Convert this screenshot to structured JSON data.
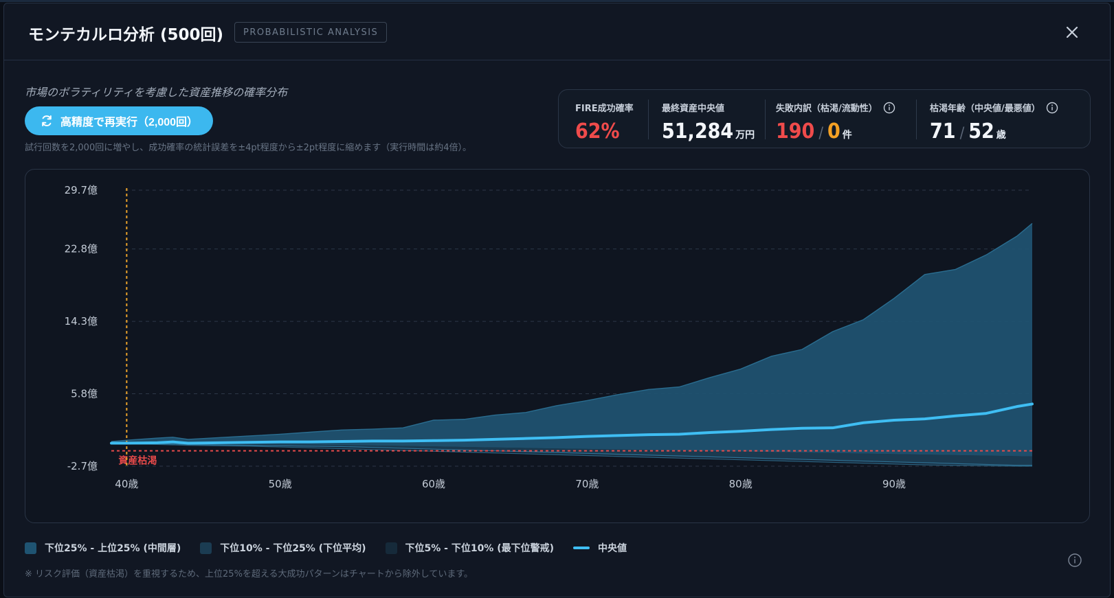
{
  "header": {
    "title": "モンテカルロ分析 (500回)",
    "badge": "PROBABILISTIC ANALYSIS"
  },
  "subtitle": "市場のボラティリティを考慮した資産推移の確率分布",
  "rerun": {
    "label": "高精度で再実行（2,000回）",
    "note": "試行回数を2,000回に増やし、成功確率の統計誤差を±4pt程度から±2pt程度に縮めます（実行時間は約4倍）。"
  },
  "stats": {
    "success": {
      "label": "FIRE成功確率",
      "value": "62%"
    },
    "median_final": {
      "label": "最終資産中央値",
      "value": "51,284",
      "unit": "万円"
    },
    "failure": {
      "label": "失敗内訳（枯渇/流動性）",
      "depletion": "190",
      "liquidity": "0",
      "unit": "件"
    },
    "depletion_age": {
      "label": "枯渇年齢（中央値/最悪値）",
      "median": "71",
      "worst": "52",
      "unit": "歳"
    }
  },
  "colors": {
    "band_iqr": "#1f5472",
    "band_p10": "#1a3a50",
    "band_p5": "#16283a",
    "median": "#3fbef3",
    "depletion_line": "#e74a4a",
    "start_line": "#e9a12a",
    "success": "#ef4b4b",
    "warn": "#f4a124"
  },
  "chart_data": {
    "type": "area",
    "y_tick_labels": [
      "29.7億",
      "22.8億",
      "14.3億",
      "5.8億",
      "-2.7億"
    ],
    "y_ticks": [
      29.7,
      22.8,
      14.3,
      5.8,
      -2.7
    ],
    "ylim": [
      -2.7,
      29.7
    ],
    "x_tick_labels": [
      "40歳",
      "50歳",
      "60歳",
      "70歳",
      "80歳",
      "90歳"
    ],
    "x_ticks": [
      40,
      50,
      60,
      70,
      80,
      90
    ],
    "xlim": [
      39,
      99
    ],
    "grid": true,
    "start_age": 40,
    "depletion_label": "資産枯渇",
    "depletion_value": -0.9,
    "x": [
      39,
      40,
      42,
      43,
      44,
      46,
      48,
      50,
      52,
      54,
      56,
      58,
      60,
      62,
      64,
      66,
      68,
      70,
      72,
      74,
      76,
      78,
      80,
      82,
      84,
      86,
      88,
      90,
      92,
      94,
      96,
      98,
      99
    ],
    "series": [
      {
        "name": "下位25% - 上位25% (中間層)",
        "role": "upper",
        "values": [
          0.2,
          0.35,
          0.6,
          0.7,
          0.45,
          0.65,
          0.85,
          1.05,
          1.3,
          1.55,
          1.65,
          1.8,
          2.7,
          2.8,
          3.3,
          3.6,
          4.4,
          5.0,
          5.7,
          6.3,
          6.6,
          7.7,
          8.7,
          10.2,
          11.0,
          13.1,
          14.5,
          17.0,
          19.8,
          20.4,
          22.1,
          24.3,
          25.8
        ]
      },
      {
        "name": "中央値",
        "role": "median",
        "values": [
          0.0,
          0.0,
          0.05,
          0.15,
          0.0,
          0.05,
          0.1,
          0.15,
          0.15,
          0.2,
          0.25,
          0.25,
          0.3,
          0.35,
          0.45,
          0.55,
          0.65,
          0.8,
          0.9,
          1.0,
          1.05,
          1.25,
          1.4,
          1.6,
          1.75,
          1.8,
          2.4,
          2.7,
          2.85,
          3.2,
          3.5,
          4.3,
          4.6
        ]
      },
      {
        "name": "下位10% - 下位25% (下位平均)",
        "role": "p10",
        "values": [
          0.0,
          -0.05,
          -0.05,
          -0.1,
          -0.15,
          -0.2,
          -0.25,
          -0.3,
          -0.35,
          -0.4,
          -0.5,
          -0.6,
          -0.7,
          -0.8,
          -0.9,
          -1.0,
          -1.1,
          -1.2,
          -1.3,
          -1.4,
          -1.5,
          -1.6,
          -1.7,
          -1.8,
          -1.9,
          -2.0,
          -2.1,
          -2.2,
          -2.3,
          -2.4,
          -2.5,
          -2.6,
          -2.6
        ]
      },
      {
        "name": "下位5% - 下位10% (最下位警戒)",
        "role": "p5",
        "values": [
          0.0,
          -0.1,
          -0.15,
          -0.2,
          -0.25,
          -0.3,
          -0.35,
          -0.45,
          -0.55,
          -0.65,
          -0.75,
          -0.85,
          -0.95,
          -1.05,
          -1.15,
          -1.25,
          -1.35,
          -1.45,
          -1.55,
          -1.65,
          -1.75,
          -1.85,
          -1.95,
          -2.05,
          -2.15,
          -2.25,
          -2.35,
          -2.45,
          -2.55,
          -2.6,
          -2.65,
          -2.7,
          -2.7
        ]
      },
      {
        "name": "",
        "role": "p25",
        "values": [
          0.0,
          -0.02,
          -0.03,
          -0.05,
          -0.07,
          -0.1,
          -0.12,
          -0.15,
          -0.18,
          -0.22,
          -0.27,
          -0.32,
          -0.38,
          -0.44,
          -0.5,
          -0.56,
          -0.62,
          -0.68,
          -0.74,
          -0.8,
          -0.86,
          -0.92,
          -0.98,
          -1.04,
          -1.1,
          -1.16,
          -1.22,
          -1.28,
          -1.34,
          -1.4,
          -1.46,
          -1.52,
          -1.55
        ]
      }
    ]
  },
  "legend": [
    {
      "label": "下位25% - 上位25% (中間層)",
      "kind": "swatch",
      "color": "#1f5472"
    },
    {
      "label": "下位10% - 下位25% (下位平均)",
      "kind": "swatch",
      "color": "#1b3c52"
    },
    {
      "label": "下位5% - 下位10% (最下位警戒)",
      "kind": "swatch",
      "color": "#162a3a"
    },
    {
      "label": "中央値",
      "kind": "line",
      "color": "#3fbef3"
    }
  ],
  "footnote": "※ リスク評価（資産枯渇）を重視するため、上位25%を超える大成功パターンはチャートから除外しています。"
}
